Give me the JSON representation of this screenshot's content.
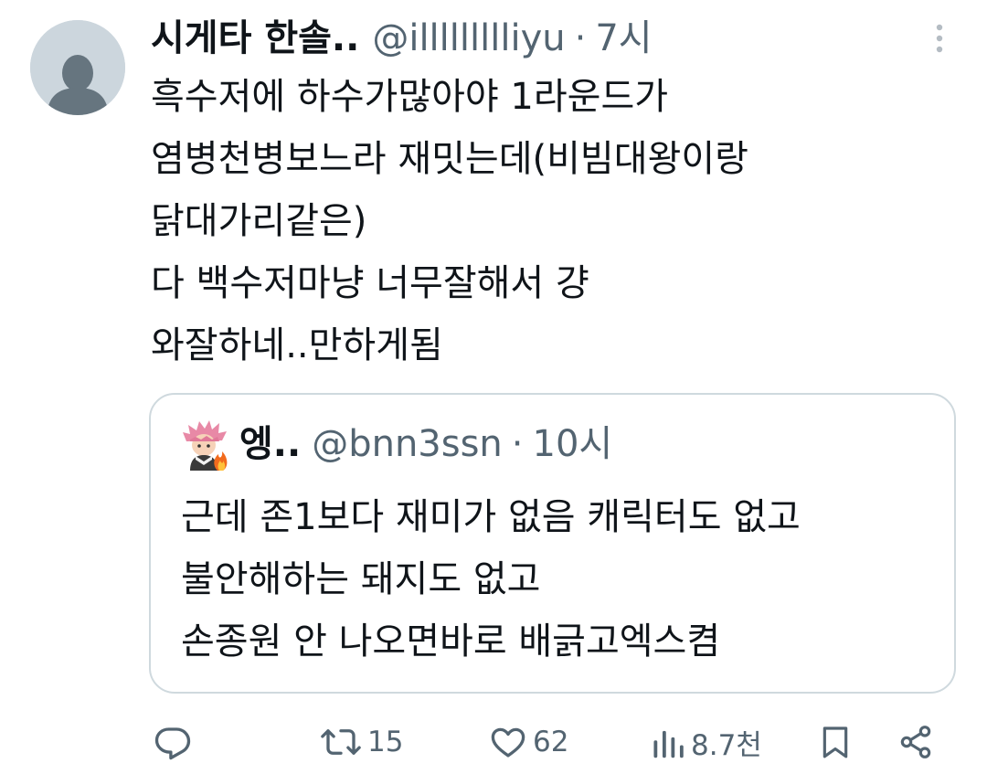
{
  "tweet": {
    "author": {
      "display_name": "시게타 한솔..",
      "handle": "@illllllllliyu",
      "separator": "·",
      "time": "7시"
    },
    "text_lines": [
      "흑수저에 하수가많아야 1라운드가",
      "염병천병보느라 재밋는데(비빔대왕이랑",
      "닭대가리같은)",
      "다 백수저마냥 너무잘해서 걍",
      "와잘하네..만하게됨"
    ],
    "more_icon": "vertical-ellipsis-icon"
  },
  "quoted_tweet": {
    "author": {
      "display_name": "엥..",
      "handle": "@bnn3ssn",
      "separator": "·",
      "time": "10시"
    },
    "text_lines": [
      "근데 존1보다 재미가 없음 캐릭터도 없고",
      "불안해하는 돼지도 없고",
      "손종원 안 나오면바로 배긁고엑스켬"
    ]
  },
  "actions": {
    "reply": {
      "icon": "reply-icon",
      "count": ""
    },
    "retweet": {
      "icon": "retweet-icon",
      "count": "15"
    },
    "like": {
      "icon": "heart-icon",
      "count": "62"
    },
    "views": {
      "icon": "views-icon",
      "count": "8.7천"
    },
    "bookmark": {
      "icon": "bookmark-icon"
    },
    "share": {
      "icon": "share-icon"
    }
  },
  "colors": {
    "text_primary": "#0f1419",
    "text_secondary": "#536471",
    "border": "#cfd9de",
    "avatar_placeholder": "#ccd6dd"
  }
}
